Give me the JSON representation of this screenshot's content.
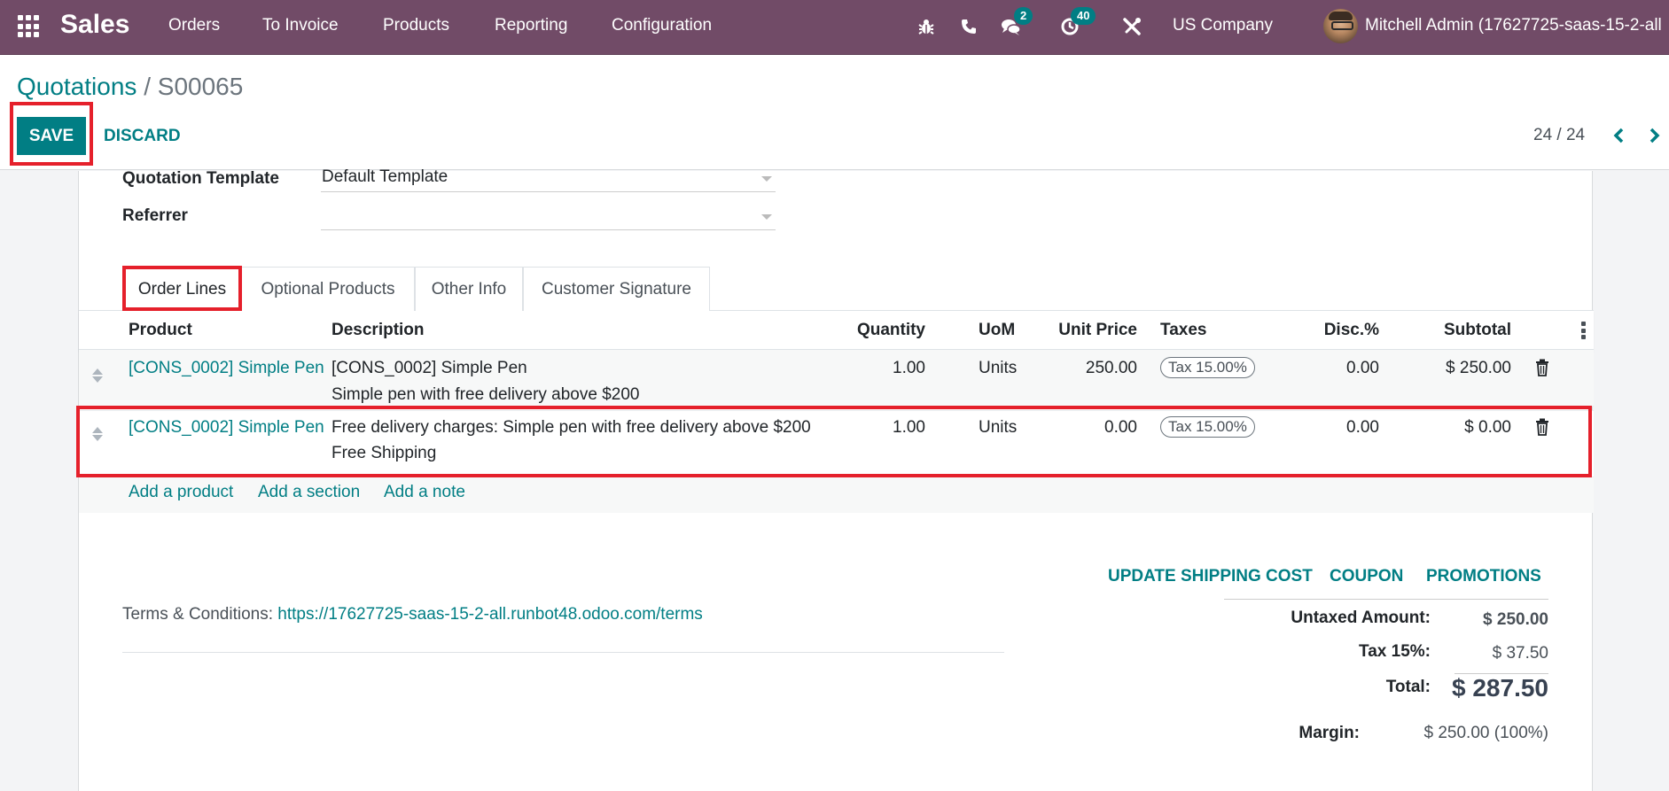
{
  "navbar": {
    "app_name": "Sales",
    "menu": [
      "Orders",
      "To Invoice",
      "Products",
      "Reporting",
      "Configuration"
    ],
    "messages_badge": "2",
    "activities_badge": "40",
    "company": "US Company",
    "user": "Mitchell Admin (17627725-saas-15-2-all"
  },
  "control_panel": {
    "breadcrumb_parent": "Quotations",
    "breadcrumb_separator": "/",
    "breadcrumb_current": "S00065",
    "save_label": "SAVE",
    "discard_label": "DISCARD",
    "pager": "24 / 24"
  },
  "form": {
    "fields": [
      {
        "label": "Quotation Template",
        "value": "Default Template"
      },
      {
        "label": "Referrer",
        "value": ""
      }
    ],
    "tabs": [
      "Order Lines",
      "Optional Products",
      "Other Info",
      "Customer Signature"
    ],
    "active_tab": "Order Lines"
  },
  "order_lines": {
    "columns": [
      "Product",
      "Description",
      "Quantity",
      "UoM",
      "Unit Price",
      "Taxes",
      "Disc.%",
      "Subtotal"
    ],
    "rows": [
      {
        "product": "[CONS_0002] Simple Pen",
        "description_line1": "[CONS_0002] Simple Pen",
        "description_line2": "Simple pen with free delivery above $200",
        "quantity": "1.00",
        "uom": "Units",
        "unit_price": "250.00",
        "taxes": "Tax 15.00%",
        "discount": "0.00",
        "subtotal": "$ 250.00"
      },
      {
        "product": "[CONS_0002] Simple Pen",
        "description_line1": "Free delivery charges: Simple pen with free delivery above $200",
        "description_line2": "Free Shipping",
        "quantity": "1.00",
        "uom": "Units",
        "unit_price": "0.00",
        "taxes": "Tax 15.00%",
        "discount": "0.00",
        "subtotal": "$ 0.00"
      }
    ],
    "add_links": [
      "Add a product",
      "Add a section",
      "Add a note"
    ]
  },
  "actions": [
    "UPDATE SHIPPING COST",
    "COUPON",
    "PROMOTIONS"
  ],
  "terms": {
    "label": "Terms & Conditions:",
    "link": "https://17627725-saas-15-2-all.runbot48.odoo.com/terms"
  },
  "totals": {
    "untaxed_label": "Untaxed Amount:",
    "untaxed_value": "$ 250.00",
    "tax_label": "Tax 15%:",
    "tax_value": "$ 37.50",
    "total_label": "Total:",
    "total_value": "$ 287.50",
    "margin_label": "Margin:",
    "margin_value": "$ 250.00 (100%)"
  },
  "colors": {
    "navbar": "#714B67",
    "primary": "#017e84",
    "highlight": "#e5202b"
  }
}
